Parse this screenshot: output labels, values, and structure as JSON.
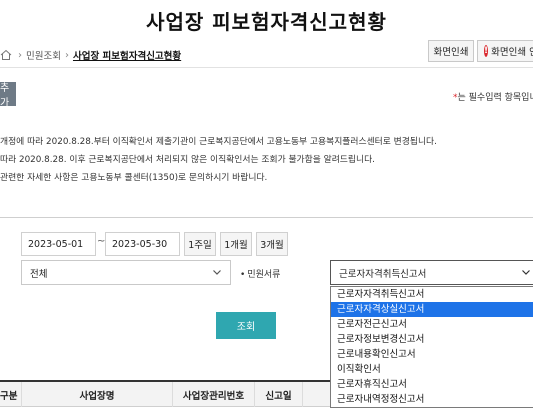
{
  "page": {
    "title": "사업장 피보험자격신고현황"
  },
  "breadcrumb": {
    "items": [
      "민원조회",
      "사업장 피보험자격신고현황"
    ]
  },
  "top_buttons": {
    "print": "화면인쇄",
    "print_guide": "화면인쇄 안"
  },
  "left_button": {
    "label": "추가"
  },
  "required_note": {
    "star": "*",
    "text": "는 필수입력 항목입니"
  },
  "notice": {
    "lines": [
      "개정에 따라 2020.8.28.부터 이직확인서 제출기관이 근로복지공단에서 고용노동부 고용복지플러스센터로 변경됩니다.",
      "따라 2020.8.28. 이후 근로복지공단에서 처리되지 않은 이직확인서는 조회가 불가함을 알려드립니다.",
      "관련한 자세한 사항은 고용노동부 콜센터(1350)로 문의하시기 바랍니다."
    ]
  },
  "search": {
    "date_from": "2023-05-01",
    "date_separator": "~",
    "date_to": "2023-05-30",
    "period_buttons": [
      "1주일",
      "1개월",
      "3개월"
    ],
    "scope_select_value": "전체",
    "doc_label_dot": "•",
    "doc_label": "민원서류",
    "doc_select_value": "근로자자격취득신고서",
    "doc_options": [
      "근로자자격취득신고서",
      "근로자자격상실신고서",
      "근로자전근신고서",
      "근로자정보변경신고서",
      "근로내용확인신고서",
      "이직확인서",
      "근로자휴직신고서",
      "근로자내역정정신고서"
    ],
    "doc_selected_index": 1,
    "submit_label": "조회"
  },
  "table": {
    "headers": [
      "구분",
      "사업장명",
      "사업장관리번호",
      "신고일",
      ""
    ]
  },
  "colors": {
    "accent": "#2fa7b0",
    "selection": "#1e73e8",
    "warning": "#d9262c",
    "side_button": "#6e7a86"
  }
}
